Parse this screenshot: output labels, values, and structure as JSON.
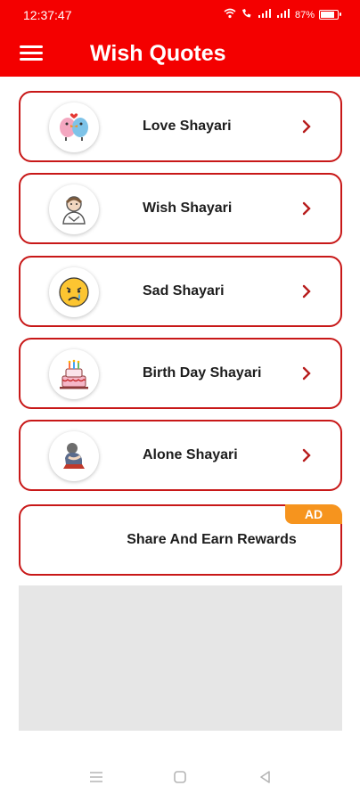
{
  "status_bar": {
    "time": "12:37:47",
    "battery_percent": "87%",
    "battery_level": 0.87,
    "icons": [
      "wifi-icon",
      "call-icon",
      "signal-icon",
      "signal-icon"
    ]
  },
  "header": {
    "title": "Wish Quotes",
    "menu_icon": "hamburger-menu-icon",
    "background": "#f40000"
  },
  "categories": [
    {
      "label": "Love Shayari",
      "icon": "love-birds-icon"
    },
    {
      "label": "Wish Shayari",
      "icon": "wishing-person-icon"
    },
    {
      "label": "Sad Shayari",
      "icon": "crying-face-icon"
    },
    {
      "label": "Birth Day Shayari",
      "icon": "birthday-cake-icon"
    },
    {
      "label": "Alone Shayari",
      "icon": "alone-person-icon"
    }
  ],
  "promo": {
    "label": "Share And Earn Rewards",
    "badge": "AD",
    "badge_color": "#f6941e"
  },
  "nav": [
    "recents-icon",
    "home-icon",
    "back-icon"
  ],
  "colors": {
    "accent": "#f40000",
    "card_border": "#c81818",
    "chevron": "#b71c1c"
  }
}
